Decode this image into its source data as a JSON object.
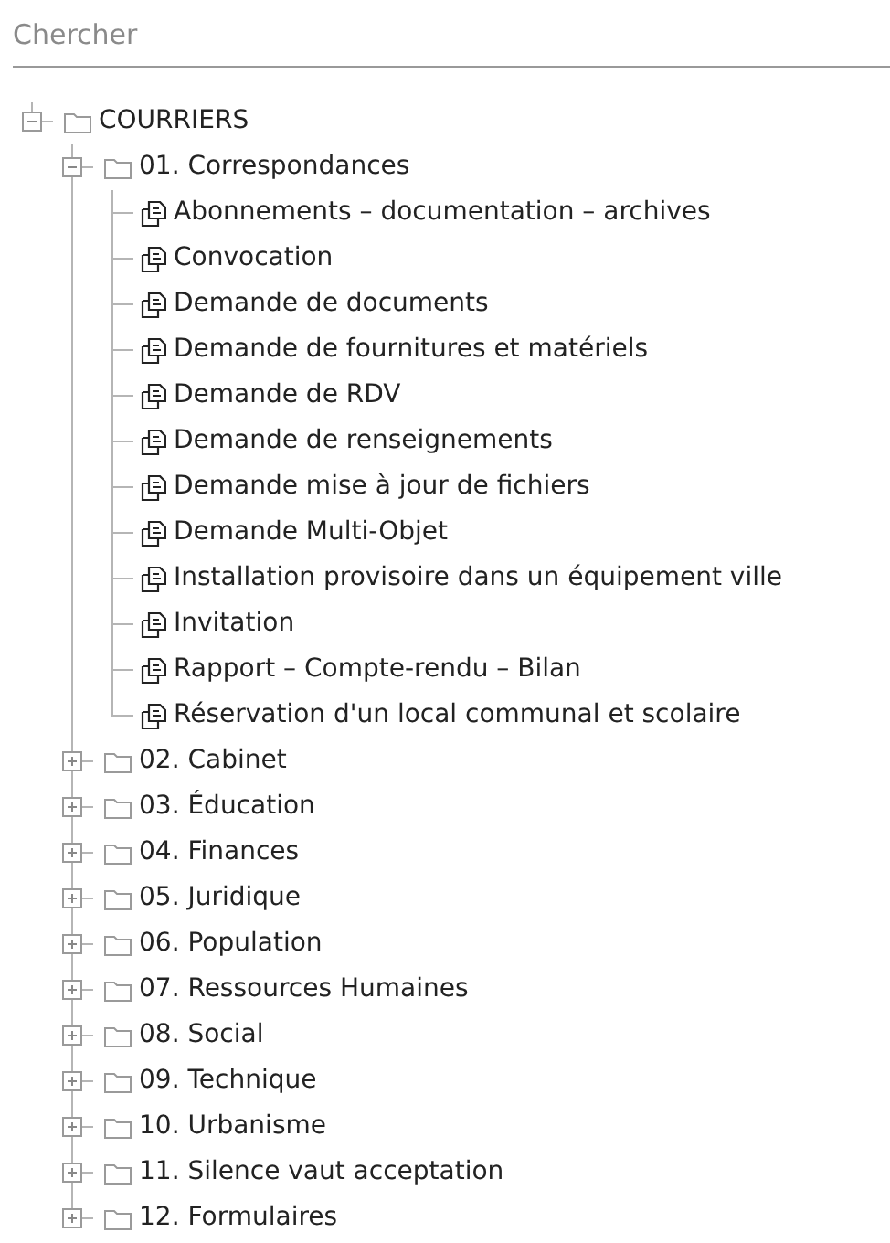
{
  "search": {
    "placeholder": "Chercher"
  },
  "tree": [
    {
      "label": "COURRIERS",
      "kind": "folder",
      "expanded": true,
      "children": [
        {
          "label": "01. Correspondances",
          "kind": "folder",
          "expanded": true,
          "children": [
            {
              "label": "Abonnements – documentation – archives",
              "kind": "document"
            },
            {
              "label": "Convocation",
              "kind": "document"
            },
            {
              "label": "Demande de documents",
              "kind": "document"
            },
            {
              "label": "Demande de fournitures et matériels",
              "kind": "document"
            },
            {
              "label": "Demande de RDV",
              "kind": "document"
            },
            {
              "label": "Demande de renseignements",
              "kind": "document"
            },
            {
              "label": "Demande mise à jour de fichiers",
              "kind": "document"
            },
            {
              "label": "Demande Multi-Objet",
              "kind": "document"
            },
            {
              "label": "Installation provisoire dans un équipement ville",
              "kind": "document"
            },
            {
              "label": "Invitation",
              "kind": "document"
            },
            {
              "label": "Rapport – Compte-rendu – Bilan",
              "kind": "document"
            },
            {
              "label": "Réservation d'un local communal et scolaire",
              "kind": "document"
            }
          ]
        },
        {
          "label": "02. Cabinet",
          "kind": "folder",
          "expanded": false
        },
        {
          "label": "03. Éducation",
          "kind": "folder",
          "expanded": false
        },
        {
          "label": "04. Finances",
          "kind": "folder",
          "expanded": false
        },
        {
          "label": "05. Juridique",
          "kind": "folder",
          "expanded": false
        },
        {
          "label": "06. Population",
          "kind": "folder",
          "expanded": false
        },
        {
          "label": "07. Ressources Humaines",
          "kind": "folder",
          "expanded": false
        },
        {
          "label": "08. Social",
          "kind": "folder",
          "expanded": false
        },
        {
          "label": "09. Technique",
          "kind": "folder",
          "expanded": false
        },
        {
          "label": "10. Urbanisme",
          "kind": "folder",
          "expanded": false
        },
        {
          "label": "11. Silence vaut acceptation",
          "kind": "folder",
          "expanded": false
        },
        {
          "label": "12. Formulaires",
          "kind": "folder",
          "expanded": false
        }
      ]
    }
  ]
}
